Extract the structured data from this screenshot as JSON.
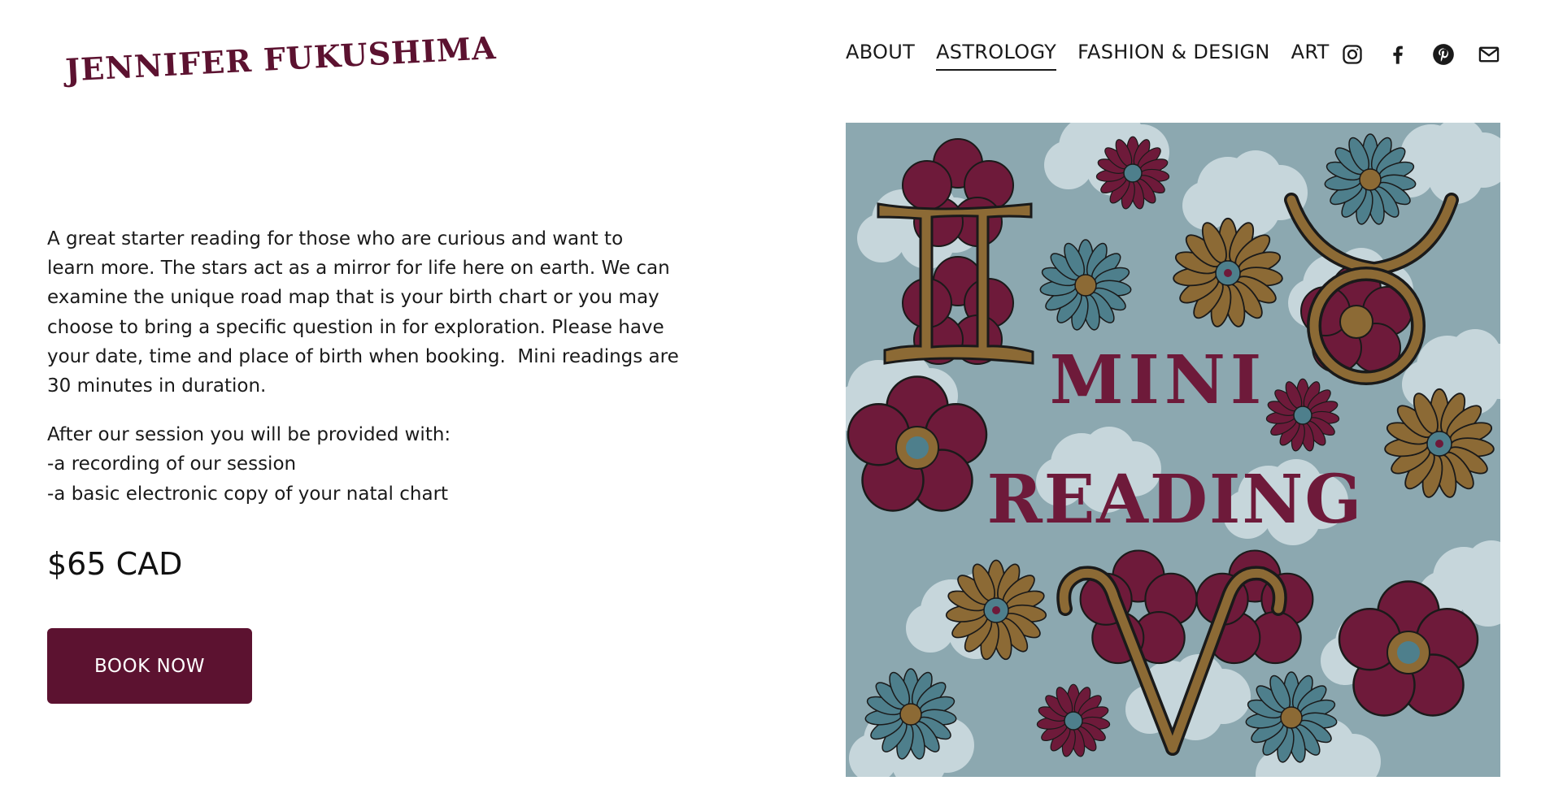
{
  "header": {
    "logo_text": "JENNIFER FUKUSHIMA",
    "nav": [
      {
        "label": "ABOUT",
        "active": false
      },
      {
        "label": "ASTROLOGY",
        "active": true
      },
      {
        "label": "FASHION & DESIGN",
        "active": false
      },
      {
        "label": "ART",
        "active": false
      }
    ],
    "social_icons": [
      "instagram-icon",
      "facebook-icon",
      "pinterest-icon",
      "mail-icon"
    ]
  },
  "main": {
    "paragraph1_lines": [
      "A great starter reading for those who are curious and want to",
      "learn more. The stars act as a mirror for life here on earth. We can",
      "examine the unique road map that is your birth chart or you may",
      "choose to bring a specific question in for exploration. Please have",
      "your date, time and place of birth when booking.  Mini readings are",
      "30 minutes in duration."
    ],
    "paragraph2_lines": [
      "After our session you will be provided with:",
      "-a recording of our session",
      "-a basic electronic copy of your natal chart"
    ],
    "price": "$65 CAD",
    "book_button": "BOOK NOW"
  },
  "artwork": {
    "title_line1": "MINI",
    "title_line2": "READING",
    "colors": {
      "background": "#8ca8b0",
      "cloud": "#c6d6db",
      "maroon": "#6e1a3a",
      "ochre": "#8c6a35",
      "teal": "#4e7f8c",
      "outline": "#1a1a1a"
    }
  },
  "colors": {
    "brand": "#5c1230",
    "text": "#1a1a1a"
  }
}
